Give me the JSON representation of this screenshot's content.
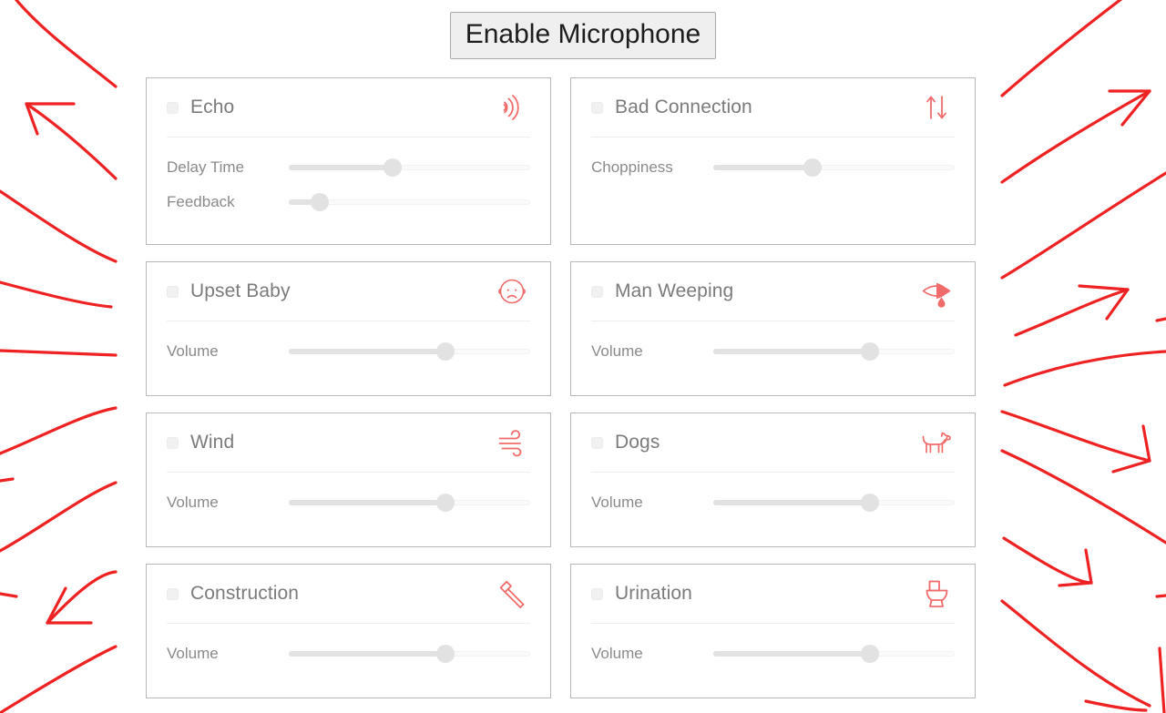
{
  "header": {
    "enable_microphone_label": "Enable Microphone"
  },
  "accent_color": "#f26b6b",
  "cards": [
    {
      "id": "echo",
      "title": "Echo",
      "icon": "echo-waves-icon",
      "checked": false,
      "size": "tall",
      "sliders": [
        {
          "label": "Delay Time",
          "value": 43
        },
        {
          "label": "Feedback",
          "value": 13
        }
      ]
    },
    {
      "id": "bad-connection",
      "title": "Bad Connection",
      "icon": "up-down-arrows-icon",
      "checked": false,
      "size": "tall",
      "sliders": [
        {
          "label": "Choppiness",
          "value": 41
        }
      ]
    },
    {
      "id": "upset-baby",
      "title": "Upset Baby",
      "icon": "sad-baby-face-icon",
      "checked": false,
      "size": "short",
      "sliders": [
        {
          "label": "Volume",
          "value": 65
        }
      ]
    },
    {
      "id": "man-weeping",
      "title": "Man Weeping",
      "icon": "crying-eye-icon",
      "checked": false,
      "size": "short",
      "sliders": [
        {
          "label": "Volume",
          "value": 65
        }
      ]
    },
    {
      "id": "wind",
      "title": "Wind",
      "icon": "wind-icon",
      "checked": false,
      "size": "short",
      "sliders": [
        {
          "label": "Volume",
          "value": 65
        }
      ]
    },
    {
      "id": "dogs",
      "title": "Dogs",
      "icon": "dog-icon",
      "checked": false,
      "size": "short",
      "sliders": [
        {
          "label": "Volume",
          "value": 65
        }
      ]
    },
    {
      "id": "construction",
      "title": "Construction",
      "icon": "hammer-icon",
      "checked": false,
      "size": "short",
      "sliders": [
        {
          "label": "Volume",
          "value": 65
        }
      ]
    },
    {
      "id": "urination",
      "title": "Urination",
      "icon": "toilet-icon",
      "checked": false,
      "size": "short",
      "sliders": [
        {
          "label": "Volume",
          "value": 65
        }
      ]
    }
  ],
  "decorations": {
    "name": "hand-drawn-red-arrows",
    "color": "#ee2222"
  }
}
